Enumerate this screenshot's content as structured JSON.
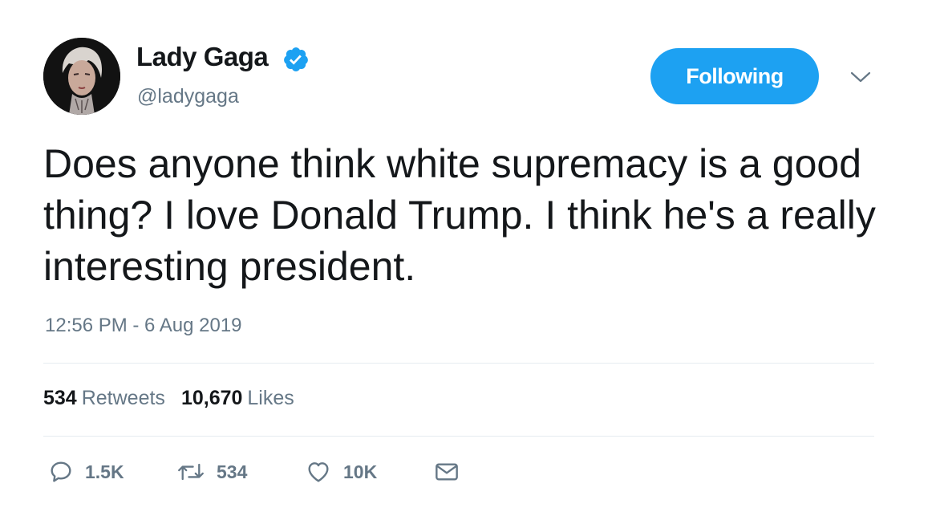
{
  "author": {
    "display_name": "Lady Gaga",
    "handle": "@ladygaga",
    "verified": true,
    "avatar_icon": "profile-photo"
  },
  "follow_button": {
    "label": "Following",
    "color": "#1da1f2"
  },
  "tweet": {
    "text": "Does anyone think white supremacy is a good thing? I love Donald Trump. I think he's a really interesting president.",
    "timestamp": "12:56 PM - 6 Aug 2019"
  },
  "stats": {
    "retweets_count": "534",
    "retweets_label": "Retweets",
    "likes_count": "10,670",
    "likes_label": "Likes"
  },
  "actions": {
    "reply_count": "1.5K",
    "retweet_count": "534",
    "like_count": "10K",
    "reply_icon": "speech-bubble-icon",
    "retweet_icon": "retweet-arrows-icon",
    "like_icon": "heart-icon",
    "dm_icon": "envelope-icon"
  },
  "colors": {
    "accent": "#1da1f2",
    "text_primary": "#14171a",
    "text_secondary": "#657786",
    "divider": "#e6ecf0"
  }
}
